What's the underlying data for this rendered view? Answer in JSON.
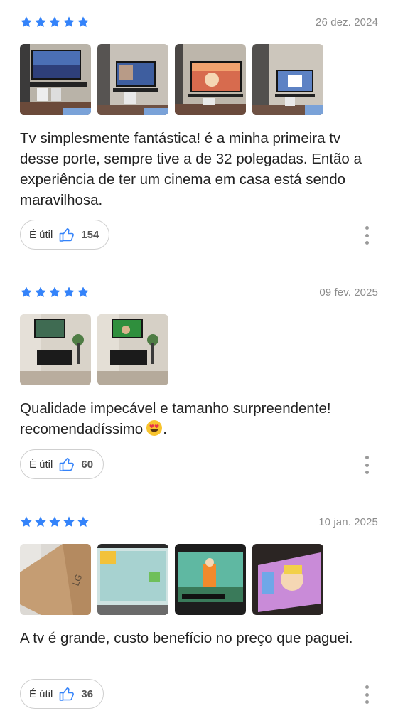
{
  "colors": {
    "star": "#3483fa",
    "thumb": "#3483fa",
    "date": "#8c8c8c"
  },
  "reviews": [
    {
      "rating": 5,
      "date": "26 dez. 2024",
      "photo_count": 4,
      "text": "Tv simplesmente fantástica! é a minha primeira tv desse porte, sempre tive a de 32 polegadas. Então a experiência de ter um cinema em casa está sendo maravilhosa.",
      "useful_label": "É útil",
      "useful_count": "154"
    },
    {
      "rating": 5,
      "date": "09 fev. 2025",
      "photo_count": 2,
      "text": "Qualidade impecável e tamanho surpreendente! recomendadíssimo",
      "text_suffix": ".",
      "emoji": "heart-eyes-emoji",
      "useful_label": "É útil",
      "useful_count": "60"
    },
    {
      "rating": 5,
      "date": "10 jan. 2025",
      "photo_count": 4,
      "text": "A tv é grande, custo benefício no preço que paguei.",
      "useful_label": "É útil",
      "useful_count": "36"
    }
  ]
}
